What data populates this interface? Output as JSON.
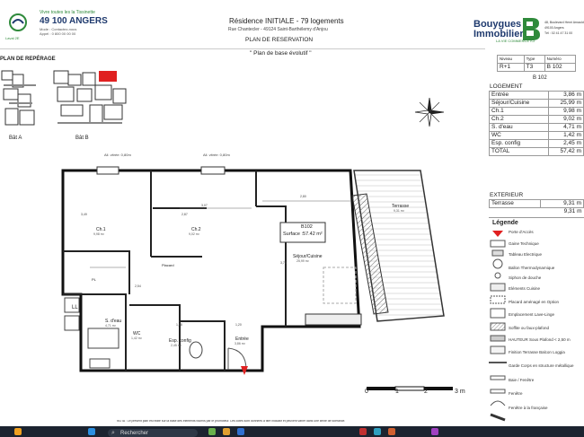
{
  "header": {
    "left_logo_caption": "Laval 2E",
    "left_slogan_1": "Vivre toutes les la Tissinette",
    "left_city": "49 100 ANGERS",
    "left_sub_1": "Mode : Contactez-nous",
    "left_sub_2": "Appel : 0 800 00 00 00",
    "residence_title": "Résidence INITIALE - 79 logements",
    "address": "Rue Chantecler - 49124 Saint-Barthélemy d'Anjou",
    "plan_title": "PLAN DE RESERVATION",
    "plan_subtitle": "\" Plan de base évolutif \"",
    "brand_line1": "Bouygues",
    "brand_line2": "Immobilier",
    "brand_tagline": "LA VIE COMMENCE ICI",
    "brand_address_1": "48, Boulevard Henri Arnauld",
    "brand_address_2": "49100 Angers",
    "brand_tel": "Tél : 02 41 47 31 00"
  },
  "reperage": {
    "title": "PLAN DE REPÉRAGE",
    "bat_a": "Bât A",
    "bat_b": "Bât B"
  },
  "lot_header": {
    "cols": [
      "Niveau",
      "Type",
      "Numéro"
    ],
    "values": [
      "R+1",
      "T3",
      "B 102"
    ]
  },
  "lot_id": "B 102",
  "logement": {
    "title": "LOGEMENT",
    "rows": [
      {
        "label": "Entrée",
        "value": "3,86 m"
      },
      {
        "label": "Séjour/Cuisine",
        "value": "25,99 m"
      },
      {
        "label": "Ch.1",
        "value": "9,98 m"
      },
      {
        "label": "Ch.2",
        "value": "9,02 m"
      },
      {
        "label": "S. d'eau",
        "value": "4,71 m"
      },
      {
        "label": "WC",
        "value": "1,42 m"
      },
      {
        "label": "Esp. config",
        "value": "2,45 m"
      },
      {
        "label": "TOTAL",
        "value": "57,42 m"
      }
    ]
  },
  "exterieur": {
    "title": "EXTERIEUR",
    "rows": [
      {
        "label": "Terrasse",
        "value": "9,31 m"
      },
      {
        "label": "",
        "value": "9,31 m"
      }
    ]
  },
  "legende": {
    "title": "Légende",
    "items": [
      "Porte d'Accès",
      "Gaine Technique",
      "Tableau Electrique",
      "Ballon Thermodynamique",
      "Siphon de douche",
      "Eléments Cuisine",
      "Placard aménagé en Option",
      "Emplacement Lave-Linge",
      "Soffite ou faux-plafond",
      "HAUTEUR Sous Plafond < 2,50 m",
      "Finition Terrasse Balcon Loggia",
      "Garde Corps en structure métallique",
      "Baie / Fenêtre",
      "Fenêtre",
      "Fenêtre à la française"
    ]
  },
  "plan": {
    "window_label_1": "All. vitrée: 0,80m",
    "window_label_2": "All. vitrée: 0,80m",
    "rooms": {
      "ch1": "Ch.1",
      "ch1_area": "9,98 m²",
      "ch2": "Ch.2",
      "ch2_area": "9,02 m²",
      "sejour": "Séjour/Cuisine",
      "sejour_area": "25,99 m²",
      "terrasse": "Terrasse",
      "terrasse_area": "9,31 m²",
      "sdeau": "S. d'eau",
      "sdeau_area": "4,71 m²",
      "wc": "WC",
      "wc_area": "1,42 m²",
      "esp_config": "Esp. config",
      "esp_area": "2,45 m²",
      "entree": "Entrée",
      "entree_area": "3,86 m²",
      "placard": "Placard",
      "ll": "LL",
      "pl": "PL"
    },
    "lot_box_line1": "B102",
    "lot_box_line2": "Surface :57.42 m²",
    "dims": [
      "2,80",
      "3,07",
      "2,87",
      "3,70",
      "1,38",
      "1,20",
      "3,49",
      "2,54"
    ],
    "scale": {
      "zero": "0",
      "one": "1",
      "two": "2",
      "unit": "3 m"
    }
  },
  "footer_note": "NOTA : Le présent plan est édité sur la base des éléments fournis par le promoteur. Les cotes sont données à titre indicatif et peuvent varier dans une limite de tolérance.",
  "taskbar": {
    "search_placeholder": "Rechercher"
  },
  "colors": {
    "green": "#2f8a3b",
    "blue": "#1f3a6e",
    "red_accent": "#e02020",
    "taskbar": "#1c2430"
  }
}
